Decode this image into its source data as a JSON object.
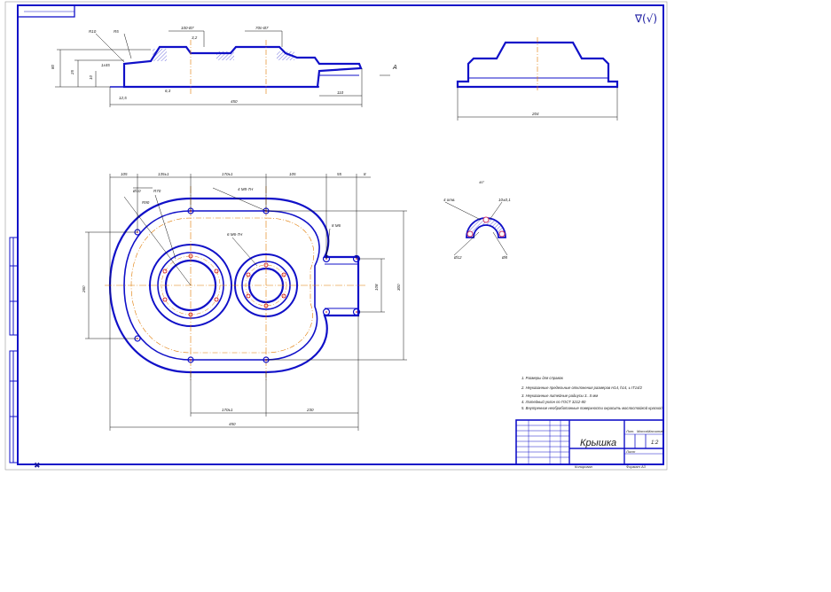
{
  "drawing": {
    "title": "Крышка",
    "scale": "1:2",
    "roughness": "∇(√)",
    "view_label": "A",
    "colors": {
      "outline": "#1010c8",
      "dimension": "#111111",
      "centerline": "#e07a00",
      "hole_center": "#cc0000",
      "background": "#ffffff"
    }
  },
  "notes": [
    "1. Размеры для справок",
    "2. Неуказанные предельные отклонения размеров H14, h14, ± IT14/2",
    "3. Неуказанные литейные радиусы 3...5 мм",
    "4. Литейный уклон по ГОСТ 3212-80",
    "5. Внутренние необработанные поверхности окрасить маслостойкой краской"
  ],
  "front_view_dims": {
    "overall_length": "450",
    "boss_length": "110",
    "height_main": "80",
    "height_flange": "25",
    "height_small": "10",
    "bore_1": "100-B7",
    "bore_2": "70n-B7",
    "radius_a": "R10",
    "radius_b": "R5",
    "chamfer": "1x45",
    "rough_1": "6,3",
    "rough_2": "3,2",
    "rough_3": "12,5"
  },
  "side_view_dims": {
    "width": "204"
  },
  "plan_view_dims": {
    "top_segments": [
      "105",
      "135±1",
      "170±1",
      "105",
      "55",
      "8"
    ],
    "holes_a": "4 M8-7H",
    "holes_b": "6 M6-7H",
    "holes_c": "8 M6",
    "hole_dia": "Ø10",
    "angle": "45°",
    "pitch_1": "R90",
    "pitch_2": "R70",
    "left_height": "260",
    "right_height_1": "108",
    "right_height_2": "300",
    "bottom_center": "170±1",
    "bottom_right": "230",
    "overall_width": "450"
  },
  "section_dims": {
    "label_a": "4 отв.",
    "label_b": "10±0,1",
    "label_c": "Ø12",
    "label_d": "Ø8"
  },
  "title_block": {
    "stage": "Лит.",
    "mass": "Масса",
    "scale_label": "Масштаб",
    "sheet": "Лист",
    "format_label": "Формат  А3",
    "copied_label": "Копировал"
  }
}
